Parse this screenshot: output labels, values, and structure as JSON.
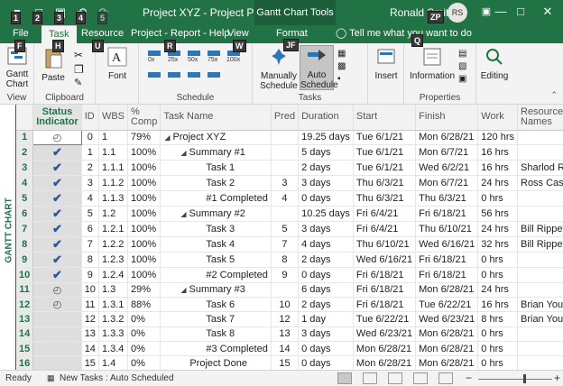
{
  "window": {
    "title": "Project XYZ  -  Project Prof...",
    "contextual_tab": "Gantt Chart Tools",
    "user_name": "Ronald Smith",
    "user_initials": "RS",
    "user_keytip": "ZP",
    "controls": [
      "—",
      "□",
      "✕"
    ],
    "qat_keytips": [
      "1",
      "2",
      "3",
      "4",
      "5"
    ]
  },
  "tabs": [
    {
      "label": "File",
      "keytip": "F"
    },
    {
      "label": "Task",
      "keytip": "H",
      "active": true
    },
    {
      "label": "Resource",
      "keytip": "U"
    },
    {
      "label": "Project - Report - Help",
      "keytip": "R"
    },
    {
      "label": "View",
      "keytip": "W"
    },
    {
      "label": "Format",
      "keytip": "JF"
    }
  ],
  "tell_me": {
    "text": "Tell me what you want to do",
    "keytip": "Q"
  },
  "ribbon": {
    "groups": [
      {
        "label": "View",
        "buttons": [
          "Gantt Chart"
        ]
      },
      {
        "label": "Clipboard",
        "buttons": [
          "Paste"
        ]
      },
      {
        "label": "Font",
        "buttons": [
          "Font"
        ]
      },
      {
        "label": "Schedule",
        "buttons": []
      },
      {
        "label": "Tasks",
        "buttons": [
          "Manually Schedule",
          "Auto Schedule"
        ]
      },
      {
        "label": "",
        "buttons": [
          "Insert"
        ]
      },
      {
        "label": "Properties",
        "buttons": [
          "Information"
        ]
      },
      {
        "label": "",
        "buttons": [
          "Editing"
        ]
      }
    ],
    "gantt_chart_label": "Gantt\nChart",
    "paste_label": "Paste",
    "font_label": "Font",
    "manually_label": "Manually\nSchedule",
    "auto_label": "Auto\nSchedule",
    "insert_label": "Insert",
    "information_label": "Information",
    "editing_label": "Editing",
    "schedule_pcts": [
      "0x",
      "25x",
      "50x",
      "75x",
      "100x"
    ]
  },
  "grid": {
    "side_label": "GANTT CHART",
    "columns": [
      "Status Indicator",
      "ID",
      "WBS",
      "% Comp",
      "Task Name",
      "Pred",
      "Duration",
      "Start",
      "Finish",
      "Work",
      "Resource Names"
    ],
    "rows": [
      {
        "n": "1",
        "status": "partial",
        "id": "0",
        "wbs": "1",
        "pct": "79%",
        "name": "Project XYZ",
        "indent": 0,
        "summary": true,
        "pred": "",
        "duration": "19.25 days",
        "start": "Tue 6/1/21",
        "finish": "Mon 6/28/21",
        "work": "120 hrs",
        "res": ""
      },
      {
        "n": "2",
        "status": "check",
        "id": "1",
        "wbs": "1.1",
        "pct": "100%",
        "name": "Summary #1",
        "indent": 1,
        "summary": true,
        "pred": "",
        "duration": "5 days",
        "start": "Tue 6/1/21",
        "finish": "Mon 6/7/21",
        "work": "16 hrs",
        "res": ""
      },
      {
        "n": "3",
        "status": "check",
        "id": "2",
        "wbs": "1.1.1",
        "pct": "100%",
        "name": "Task 1",
        "indent": 2,
        "summary": false,
        "pred": "",
        "duration": "2 days",
        "start": "Tue 6/1/21",
        "finish": "Wed 6/2/21",
        "work": "16 hrs",
        "res": "Sharlod Runns"
      },
      {
        "n": "4",
        "status": "check",
        "id": "3",
        "wbs": "1.1.2",
        "pct": "100%",
        "name": "Task 2",
        "indent": 2,
        "summary": false,
        "pred": "3",
        "duration": "3 days",
        "start": "Thu 6/3/21",
        "finish": "Mon 6/7/21",
        "work": "24 hrs",
        "res": "Ross Castillo"
      },
      {
        "n": "5",
        "status": "check",
        "id": "4",
        "wbs": "1.1.3",
        "pct": "100%",
        "name": "#1 Completed",
        "indent": 2,
        "summary": false,
        "pred": "4",
        "duration": "0 days",
        "start": "Thu 6/3/21",
        "finish": "Thu 6/3/21",
        "work": "0 hrs",
        "res": ""
      },
      {
        "n": "6",
        "status": "check",
        "id": "5",
        "wbs": "1.2",
        "pct": "100%",
        "name": "Summary #2",
        "indent": 1,
        "summary": true,
        "pred": "",
        "duration": "10.25 days",
        "start": "Fri 6/4/21",
        "finish": "Fri 6/18/21",
        "work": "56 hrs",
        "res": ""
      },
      {
        "n": "7",
        "status": "check",
        "id": "6",
        "wbs": "1.2.1",
        "pct": "100%",
        "name": "Task 3",
        "indent": 2,
        "summary": false,
        "pred": "5",
        "duration": "3 days",
        "start": "Fri 6/4/21",
        "finish": "Thu 6/10/21",
        "work": "24 hrs",
        "res": "Bill Rippey"
      },
      {
        "n": "8",
        "status": "check",
        "id": "7",
        "wbs": "1.2.2",
        "pct": "100%",
        "name": "Task 4",
        "indent": 2,
        "summary": false,
        "pred": "7",
        "duration": "4 days",
        "start": "Thu 6/10/21",
        "finish": "Wed 6/16/21",
        "work": "32 hrs",
        "res": "Bill Rippey"
      },
      {
        "n": "9",
        "status": "check",
        "id": "8",
        "wbs": "1.2.3",
        "pct": "100%",
        "name": "Task 5",
        "indent": 2,
        "summary": false,
        "pred": "8",
        "duration": "2 days",
        "start": "Wed 6/16/21",
        "finish": "Fri 6/18/21",
        "work": "0 hrs",
        "res": ""
      },
      {
        "n": "10",
        "status": "check",
        "id": "9",
        "wbs": "1.2.4",
        "pct": "100%",
        "name": "#2 Completed",
        "indent": 2,
        "summary": false,
        "pred": "9",
        "duration": "0 days",
        "start": "Fri 6/18/21",
        "finish": "Fri 6/18/21",
        "work": "0 hrs",
        "res": ""
      },
      {
        "n": "11",
        "status": "partial",
        "id": "10",
        "wbs": "1.3",
        "pct": "29%",
        "name": "Summary #3",
        "indent": 1,
        "summary": true,
        "pred": "",
        "duration": "6 days",
        "start": "Fri 6/18/21",
        "finish": "Mon 6/28/21",
        "work": "24 hrs",
        "res": ""
      },
      {
        "n": "12",
        "status": "partial",
        "id": "11",
        "wbs": "1.3.1",
        "pct": "88%",
        "name": "Task 6",
        "indent": 2,
        "summary": false,
        "pred": "10",
        "duration": "2 days",
        "start": "Fri 6/18/21",
        "finish": "Tue 6/22/21",
        "work": "16 hrs",
        "res": "Brian Youll"
      },
      {
        "n": "13",
        "status": "",
        "id": "12",
        "wbs": "1.3.2",
        "pct": "0%",
        "name": "Task 7",
        "indent": 2,
        "summary": false,
        "pred": "12",
        "duration": "1 day",
        "start": "Tue 6/22/21",
        "finish": "Wed 6/23/21",
        "work": "8 hrs",
        "res": "Brian Youll"
      },
      {
        "n": "14",
        "status": "",
        "id": "13",
        "wbs": "1.3.3",
        "pct": "0%",
        "name": "Task 8",
        "indent": 2,
        "summary": false,
        "pred": "13",
        "duration": "3 days",
        "start": "Wed 6/23/21",
        "finish": "Mon 6/28/21",
        "work": "0 hrs",
        "res": ""
      },
      {
        "n": "15",
        "status": "",
        "id": "14",
        "wbs": "1.3.4",
        "pct": "0%",
        "name": "#3 Completed",
        "indent": 2,
        "summary": false,
        "pred": "14",
        "duration": "0 days",
        "start": "Mon 6/28/21",
        "finish": "Mon 6/28/21",
        "work": "0 hrs",
        "res": ""
      },
      {
        "n": "16",
        "status": "",
        "id": "15",
        "wbs": "1.4",
        "pct": "0%",
        "name": "Project Done",
        "indent": 1,
        "summary": false,
        "pred": "15",
        "duration": "0 days",
        "start": "Mon 6/28/21",
        "finish": "Mon 6/28/21",
        "work": "0 hrs",
        "res": ""
      }
    ]
  },
  "statusbar": {
    "ready": "Ready",
    "new_tasks": "New Tasks : Auto Scheduled"
  },
  "colors": {
    "accent": "#217346",
    "check": "#2b5797"
  }
}
